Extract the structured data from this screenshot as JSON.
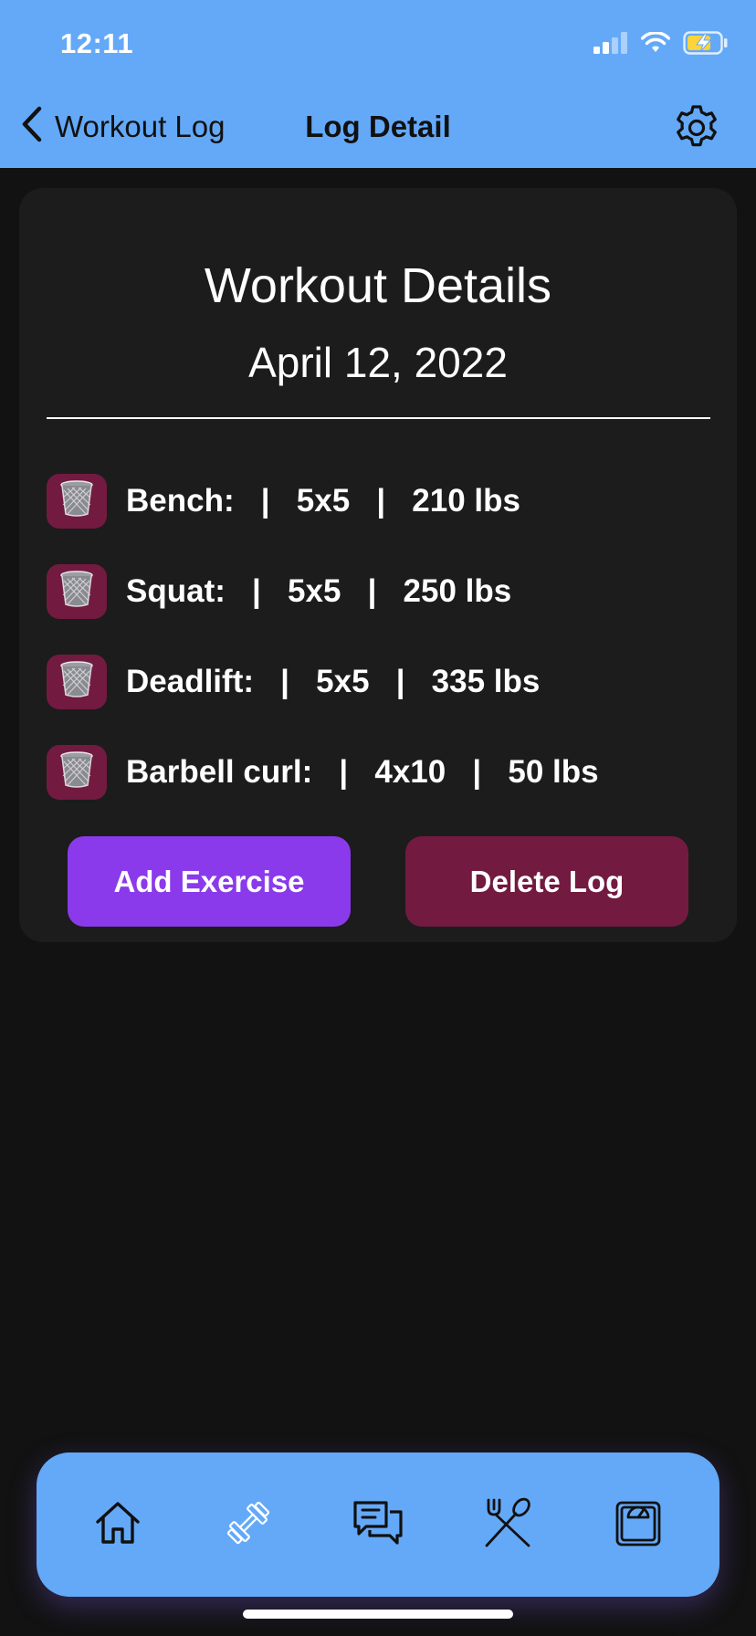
{
  "status_bar": {
    "time": "12:11"
  },
  "nav": {
    "back_label": "Workout Log",
    "title": "Log Detail"
  },
  "card": {
    "title": "Workout Details",
    "date": "April 12, 2022",
    "exercises": [
      {
        "text": "Bench:   |   5x5   |   210 lbs"
      },
      {
        "text": "Squat:   |   5x5   |   250 lbs"
      },
      {
        "text": "Deadlift:   |   5x5   |   335 lbs"
      },
      {
        "text": "Barbell curl:   |   4x10   |   50 lbs"
      }
    ],
    "add_button": "Add Exercise",
    "delete_button": "Delete Log"
  },
  "tabbar": {
    "tabs": [
      {
        "icon": "home-icon"
      },
      {
        "icon": "dumbbell-icon"
      },
      {
        "icon": "chat-icon"
      },
      {
        "icon": "fork-spoon-icon"
      },
      {
        "icon": "scale-icon"
      }
    ]
  },
  "colors": {
    "header_bg": "#64a9f8",
    "background": "#121212",
    "card_bg": "#1c1c1c",
    "add_button": "#8a3aeb",
    "delete_button": "#731a41"
  }
}
